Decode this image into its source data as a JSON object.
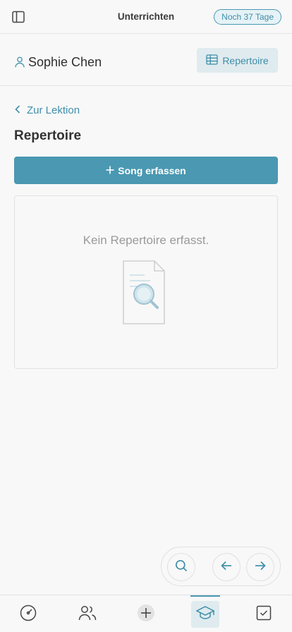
{
  "topbar": {
    "title": "Unterrichten",
    "trial_badge": "Noch 37 Tage"
  },
  "student": {
    "name": "Sophie Chen",
    "repertoire_button_label": "Repertoire"
  },
  "main": {
    "back_link_label": "Zur Lektion",
    "section_title": "Repertoire",
    "add_song_label": "Song erfassen",
    "empty_state_text": "Kein Repertoire erfasst."
  },
  "floating_nav": {
    "icons": [
      "search-icon",
      "arrow-left-icon",
      "arrow-right-icon"
    ]
  },
  "bottom_tabs": [
    {
      "icon": "dashboard-icon",
      "active": false
    },
    {
      "icon": "users-icon",
      "active": false
    },
    {
      "icon": "plus-icon",
      "active": false
    },
    {
      "icon": "graduation-cap-icon",
      "active": true
    },
    {
      "icon": "checkbox-icon",
      "active": false
    }
  ],
  "colors": {
    "accent": "#4a98b2",
    "accent_light": "#dfebef",
    "background": "#f8f8f8"
  }
}
